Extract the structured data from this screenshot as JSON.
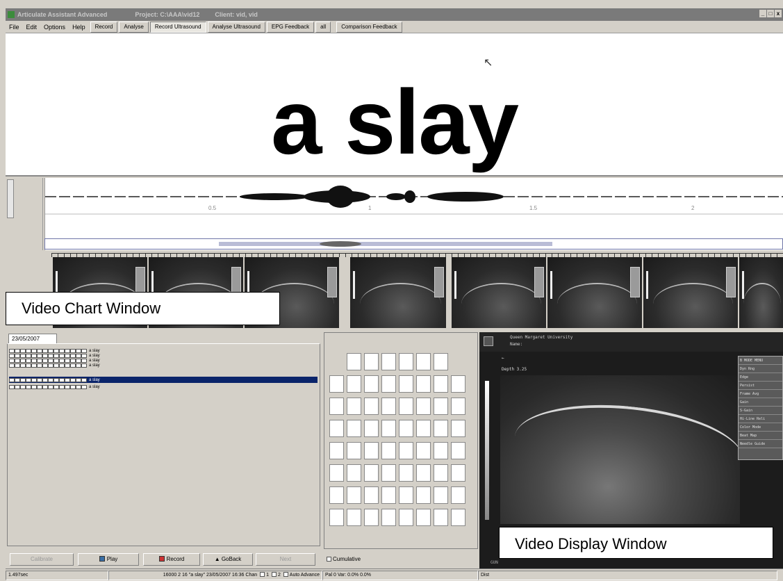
{
  "window": {
    "title": "Articulate Assistant Advanced",
    "project": "Project: C:\\AAA\\vid12",
    "client": "Client: vid, vid",
    "controls": [
      "_",
      "□",
      "x"
    ]
  },
  "menubar": {
    "menus": [
      "File",
      "Edit",
      "Options",
      "Help"
    ],
    "tabs": [
      "Record",
      "Analyse",
      "Record Ultrasound",
      "Analyse Ultrasound",
      "EPG Feedback",
      "all",
      "Comparison Feedback"
    ],
    "active_tab": "Record Ultrasound"
  },
  "prompt": {
    "word": "a slay"
  },
  "waveform": {
    "tick_labels": [
      "0.5",
      "1",
      "1.5",
      "2"
    ]
  },
  "video_chart": {
    "label": "Video Chart Window"
  },
  "session": {
    "date_tab": "23/05/2007",
    "recordings": [
      {
        "label": "a slay",
        "selected": false
      },
      {
        "label": "a slay",
        "selected": false
      },
      {
        "label": "a slay",
        "selected": false
      },
      {
        "label": "a slay",
        "selected": false
      },
      {
        "label": "a slay",
        "selected": true
      },
      {
        "label": "a slay",
        "selected": false
      }
    ]
  },
  "controls": {
    "calibrate": "Calibrate",
    "play": "Play",
    "record": "Record",
    "goback": "GoBack",
    "next": "Next"
  },
  "epg": {
    "cumulative_label": "Cumulative"
  },
  "video_display": {
    "label": "Video Display Window",
    "header_org": "Queen Margaret University",
    "header_name": "Name:",
    "depth": "Depth 3.25",
    "side_menu": [
      "B MODE MENU",
      "Dyn Rng",
      "Edge",
      "Persist",
      "Frame Avg",
      "Gain",
      "S-Gain",
      "Hi-Line Reli",
      "Color Mode",
      "Beat Map",
      "Needle Guide"
    ],
    "footer": "GUN"
  },
  "statusbar": {
    "time": "1.497sec",
    "recording_info": "16000 2 16 \"a slay\" 23/05/2007 16:36  Chan",
    "chan_1": "1",
    "chan_2": "2",
    "auto_advance": "Auto Advance",
    "pal": "Pal 0 Var: 0.0% 0.0%",
    "dist": "Dist"
  }
}
